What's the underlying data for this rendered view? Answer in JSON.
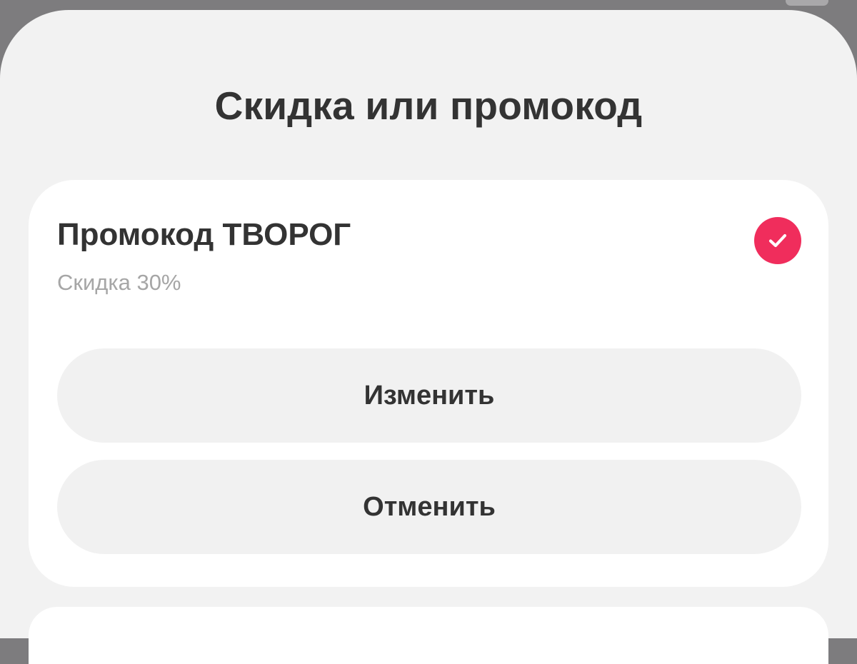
{
  "sheet": {
    "title": "Скидка или промокод"
  },
  "promo": {
    "name": "Промокод ТВОРОГ",
    "subtitle": "Скидка 30%",
    "selected": true,
    "accent_color": "#f02d5c"
  },
  "actions": {
    "change_label": "Изменить",
    "cancel_label": "Отменить"
  },
  "icons": {
    "selected": "checkmark-circle-icon"
  }
}
